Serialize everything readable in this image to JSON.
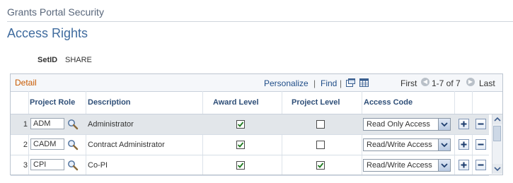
{
  "header": {
    "app_title": "Grants Portal Security",
    "page_title": "Access Rights"
  },
  "setid": {
    "label": "SetID",
    "value": "SHARE"
  },
  "grid": {
    "caption": "Detail",
    "personalize": "Personalize",
    "separator": "|",
    "find": "Find",
    "first": "First",
    "range": "1-7 of 7",
    "last": "Last",
    "columns": {
      "project_role": "Project Role",
      "description": "Description",
      "award_level": "Award Level",
      "project_level": "Project Level",
      "access_code": "Access Code"
    },
    "rows": [
      {
        "num": "1",
        "role": "ADM",
        "description": "Administrator",
        "award_level": true,
        "project_level": false,
        "access_code": "Read Only Access"
      },
      {
        "num": "2",
        "role": "CADM",
        "description": "Contract Administrator",
        "award_level": true,
        "project_level": false,
        "access_code": "Read/Write Access"
      },
      {
        "num": "3",
        "role": "CPI",
        "description": "Co-PI",
        "award_level": true,
        "project_level": true,
        "access_code": "Read/Write Access"
      }
    ]
  },
  "icons": {
    "lookup": "magnifier-icon",
    "add": "plus-icon",
    "delete": "minus-icon",
    "new_window": "new-window-icon",
    "spreadsheet": "spreadsheet-icon"
  },
  "colors": {
    "caption": "#c85a00",
    "title": "#3f6b9e",
    "link": "#1f4d88",
    "selected_row": "#e2e6ea"
  }
}
